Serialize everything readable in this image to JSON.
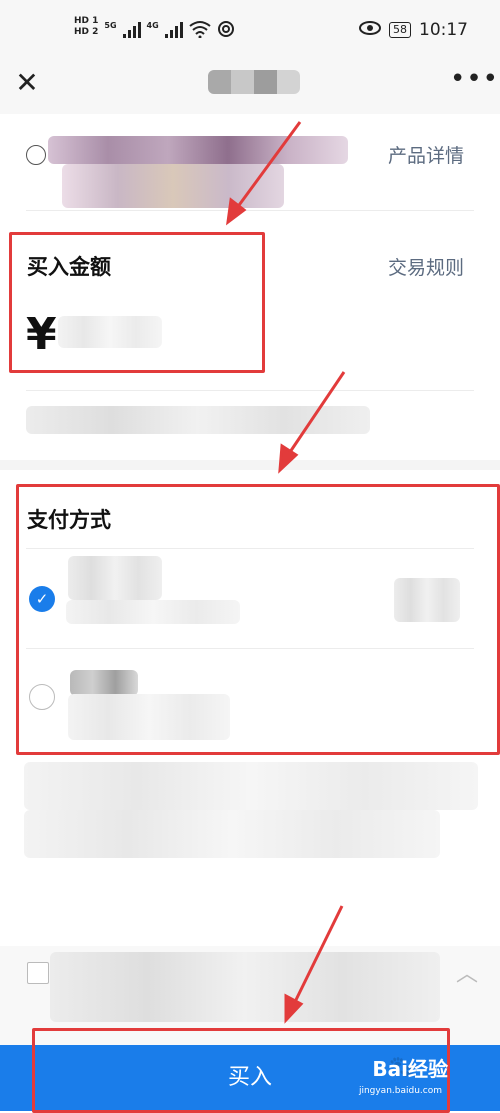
{
  "status_bar": {
    "hd1": "HD 1",
    "hd2": "HD 2",
    "net": "5G",
    "net2": "4G",
    "battery": "58",
    "time": "10:17",
    "icons": [
      "signal-icon",
      "wifi-icon",
      "eye-icon",
      "battery-icon"
    ]
  },
  "nav": {
    "close_icon": "close-icon",
    "more_icon": "more-icon"
  },
  "product": {
    "detail_link": "产品详情"
  },
  "amount": {
    "label": "买入金额",
    "rules_link": "交易规则",
    "currency": "¥"
  },
  "payment": {
    "heading": "支付方式"
  },
  "buy": {
    "label": "买入"
  },
  "watermark": {
    "text": "Bai经验",
    "sub": "jingyan.baidu.com"
  },
  "colors": {
    "accent": "#1a7dea",
    "highlight": "#e23b3b",
    "link": "#5c6b80"
  }
}
